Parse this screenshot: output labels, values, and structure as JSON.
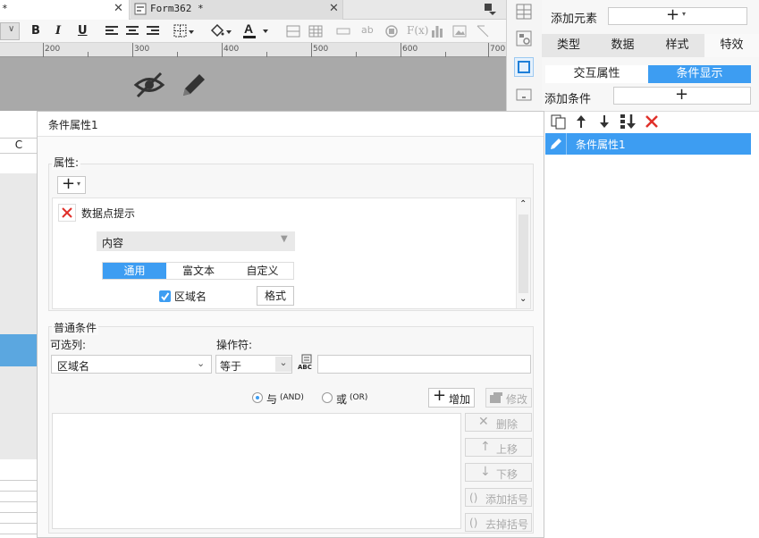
{
  "editor": {
    "tab1_suffix": "*",
    "tab2_title": "Form362 *",
    "ruler_marks": [
      "200",
      "300",
      "400",
      "500",
      "600",
      "700"
    ],
    "column_header": "C"
  },
  "right_panel": {
    "add_element_label": "添加元素",
    "tabs": [
      "类型",
      "数据",
      "样式",
      "特效"
    ],
    "subtabs": [
      "交互属性",
      "条件显示"
    ],
    "add_condition_label": "添加条件",
    "condition_list": [
      {
        "label": "条件属性1"
      }
    ]
  },
  "dialog": {
    "title": "条件属性1",
    "props_label": "属性:",
    "datapoint_label": "数据点提示",
    "content_select_value": "内容",
    "style_tabs": [
      "通用",
      "富文本",
      "自定义"
    ],
    "region_checkbox_label": "区域名",
    "format_button": "格式",
    "common_conditions_label": "普通条件",
    "column_label": "可选列:",
    "operator_label": "操作符:",
    "column_value": "区域名",
    "operator_value": "等于",
    "formula_icon_text": "ABC",
    "and_label": "与",
    "and_code": "(AND)",
    "or_label": "或",
    "or_code": "(OR)",
    "add_button": "增加",
    "modify_button": "修改",
    "delete_button": "删除",
    "move_up_button": "上移",
    "move_down_button": "下移",
    "add_bracket_button": "添加括号",
    "remove_bracket_button": "去掉括号"
  },
  "colors": {
    "accent": "#3d9df2",
    "delete_red": "#e0302a"
  }
}
